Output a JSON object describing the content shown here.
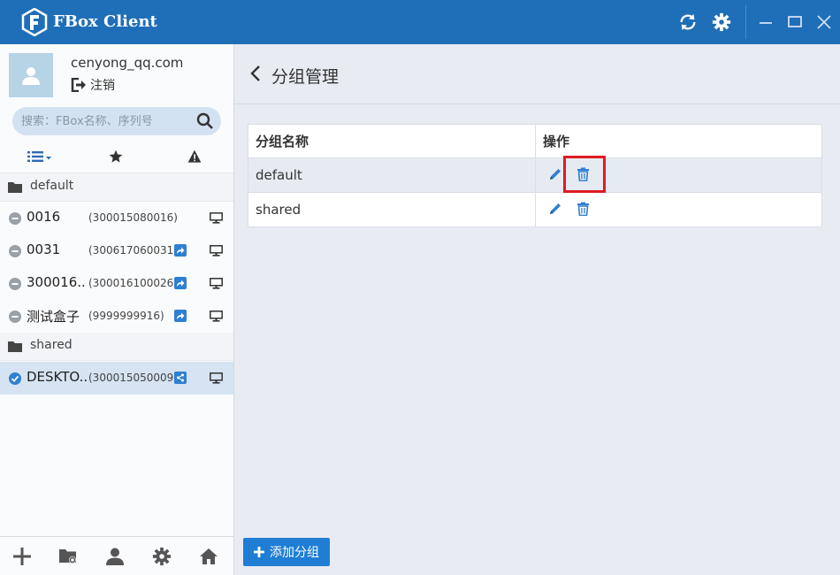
{
  "app": {
    "title": "FBox Client"
  },
  "user": {
    "name": "cenyong_qq.com",
    "logout_label": "注销"
  },
  "search": {
    "placeholder": "搜索：FBox名称、序列号"
  },
  "groups": [
    {
      "name": "default",
      "devices": [
        {
          "name": "0016",
          "serial": "(300015080016)",
          "shared": false
        },
        {
          "name": "0031",
          "serial": "(300617060031)",
          "shared": true
        },
        {
          "name": "300016..",
          "serial": "(300016100026)",
          "shared": true
        },
        {
          "name": "测试盒子",
          "serial": "(9999999916)",
          "shared": true
        }
      ]
    },
    {
      "name": "shared",
      "devices": [
        {
          "name": "DESKTO..",
          "serial": "(300015050009)",
          "shared": true,
          "selected": true
        }
      ]
    }
  ],
  "main": {
    "title": "分组管理",
    "table": {
      "headers": [
        "分组名称",
        "操作"
      ],
      "rows": [
        {
          "name": "default"
        },
        {
          "name": "shared"
        }
      ]
    },
    "add_button_label": "添加分组"
  },
  "colors": {
    "titlebar": "#1f6eb8",
    "accent": "#2f7fd1",
    "highlight": "#e11b22"
  }
}
